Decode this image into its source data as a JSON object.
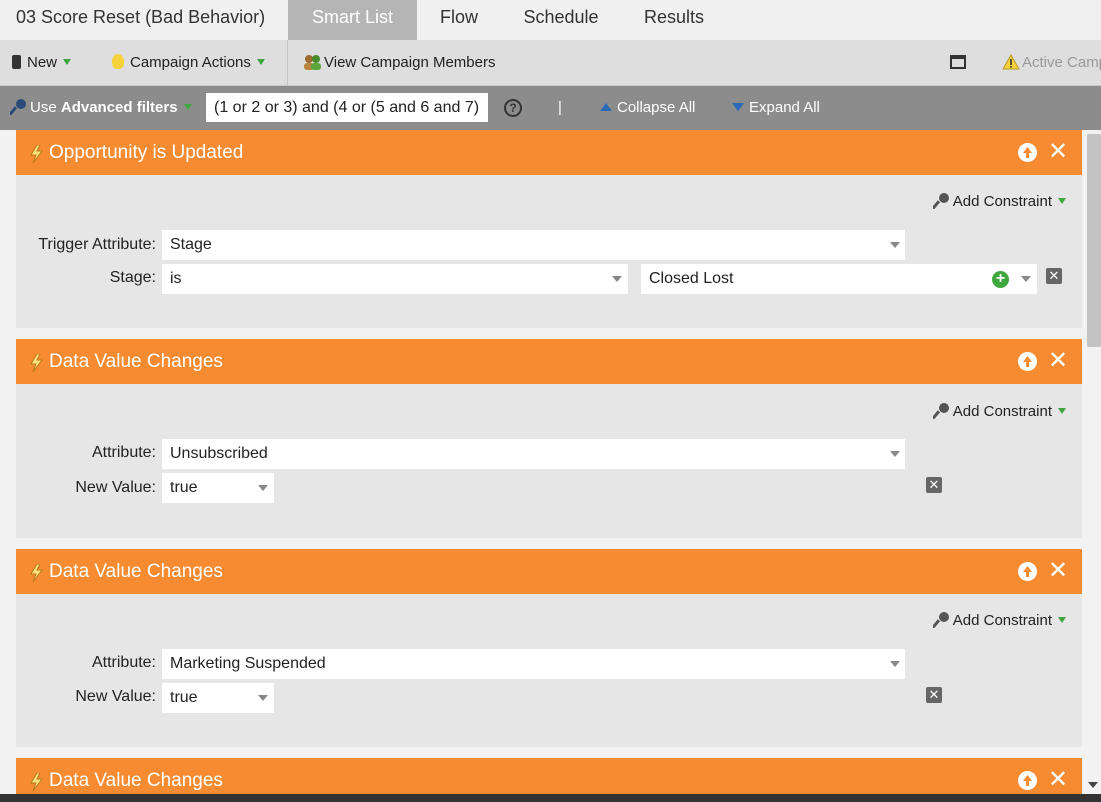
{
  "tabs": {
    "campaign_title": "03 Score Reset (Bad Behavior)",
    "items": [
      "Smart List",
      "Flow",
      "Schedule",
      "Results"
    ],
    "active": "Smart List"
  },
  "toolbar": {
    "new_label": "New",
    "campaign_actions_label": "Campaign Actions",
    "view_members_label": "View Campaign Members",
    "active_status_label": "Active Camp"
  },
  "filterbar": {
    "use_label": "Use",
    "advanced_label": "Advanced filters",
    "logic": "(1 or 2 or 3) and (4 or (5 and 6 and 7)",
    "help": "?",
    "separator": "|",
    "collapse_all": "Collapse All",
    "expand_all": "Expand All"
  },
  "filters": [
    {
      "title": "Opportunity is Updated",
      "add_constraint": "Add Constraint",
      "trigger_attribute_label": "Trigger Attribute:",
      "trigger_attribute_value": "Stage",
      "stage_label": "Stage:",
      "stage_operator": "is",
      "stage_value": "Closed Lost"
    },
    {
      "title": "Data Value Changes",
      "add_constraint": "Add Constraint",
      "attribute_label": "Attribute:",
      "attribute_value": "Unsubscribed",
      "new_value_label": "New Value:",
      "new_value": "true"
    },
    {
      "title": "Data Value Changes",
      "add_constraint": "Add Constraint",
      "attribute_label": "Attribute:",
      "attribute_value": "Marketing Suspended",
      "new_value_label": "New Value:",
      "new_value": "true"
    },
    {
      "title": "Data Value Changes"
    }
  ],
  "colors": {
    "filter_header": "#f68b31",
    "active_tab": "#b5b5b5",
    "filter_bar": "#8c8c8c",
    "caret_green": "#3ea83e"
  }
}
